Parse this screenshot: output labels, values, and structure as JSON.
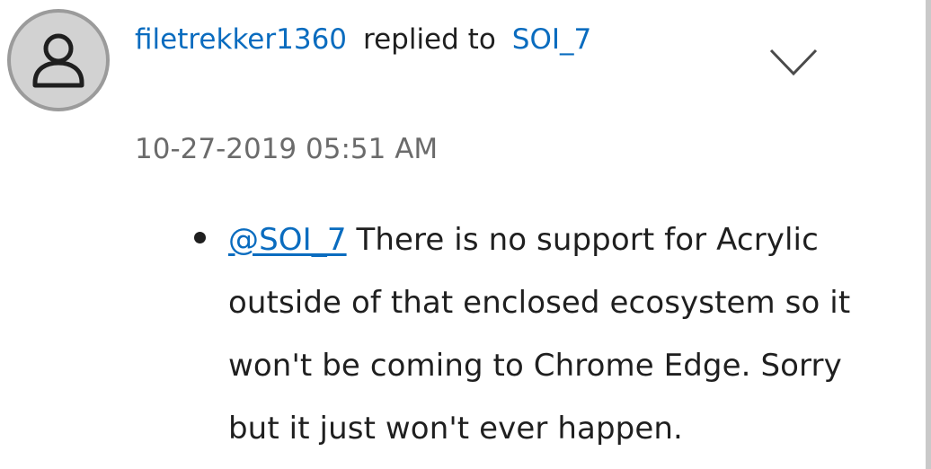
{
  "post": {
    "author": "filetrekker1360",
    "action": "replied to",
    "reply_target": "SOI_7",
    "timestamp": "10-27-2019 05:51 AM",
    "menu_icon": "chevron-down-icon",
    "avatar_icon": "user-icon",
    "body": {
      "mention": "@SOI_7",
      "text": " There is no support for Acrylic outside of that enclosed ecosystem so it won't be coming to Chrome Edge. Sorry but it just won't ever happen."
    }
  },
  "colors": {
    "link": "#0a6cbf",
    "text": "#1f1f1f",
    "meta": "#6b6b6b",
    "avatar_bg": "#d2d2d2",
    "avatar_border": "#9b9b9b"
  }
}
